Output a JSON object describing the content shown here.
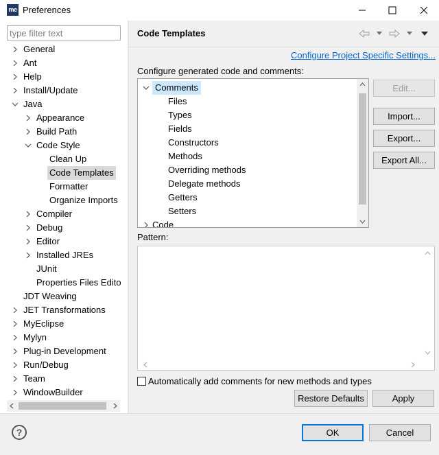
{
  "window": {
    "title": "Preferences",
    "app_icon_text": "me"
  },
  "left": {
    "filter_placeholder": "type filter text",
    "tree": [
      {
        "label": "General",
        "level": 0,
        "arrow": "right"
      },
      {
        "label": "Ant",
        "level": 0,
        "arrow": "right"
      },
      {
        "label": "Help",
        "level": 0,
        "arrow": "right"
      },
      {
        "label": "Install/Update",
        "level": 0,
        "arrow": "right"
      },
      {
        "label": "Java",
        "level": 0,
        "arrow": "down"
      },
      {
        "label": "Appearance",
        "level": 1,
        "arrow": "right"
      },
      {
        "label": "Build Path",
        "level": 1,
        "arrow": "right"
      },
      {
        "label": "Code Style",
        "level": 1,
        "arrow": "down"
      },
      {
        "label": "Clean Up",
        "level": 2,
        "arrow": "none"
      },
      {
        "label": "Code Templates",
        "level": 2,
        "arrow": "none",
        "selected": true
      },
      {
        "label": "Formatter",
        "level": 2,
        "arrow": "none"
      },
      {
        "label": "Organize Imports",
        "level": 2,
        "arrow": "none"
      },
      {
        "label": "Compiler",
        "level": 1,
        "arrow": "right"
      },
      {
        "label": "Debug",
        "level": 1,
        "arrow": "right"
      },
      {
        "label": "Editor",
        "level": 1,
        "arrow": "right"
      },
      {
        "label": "Installed JREs",
        "level": 1,
        "arrow": "right"
      },
      {
        "label": "JUnit",
        "level": 1,
        "arrow": "none"
      },
      {
        "label": "Properties Files Edito",
        "level": 1,
        "arrow": "none"
      },
      {
        "label": "JDT Weaving",
        "level": 0,
        "arrow": "none"
      },
      {
        "label": "JET Transformations",
        "level": 0,
        "arrow": "right"
      },
      {
        "label": "MyEclipse",
        "level": 0,
        "arrow": "right"
      },
      {
        "label": "Mylyn",
        "level": 0,
        "arrow": "right"
      },
      {
        "label": "Plug-in Development",
        "level": 0,
        "arrow": "right"
      },
      {
        "label": "Run/Debug",
        "level": 0,
        "arrow": "right"
      },
      {
        "label": "Team",
        "level": 0,
        "arrow": "right"
      },
      {
        "label": "WindowBuilder",
        "level": 0,
        "arrow": "right"
      }
    ]
  },
  "right": {
    "title": "Code Templates",
    "project_link": "Configure Project Specific Settings...",
    "config_label": "Configure generated code and comments:",
    "templates": [
      {
        "label": "Comments",
        "level": 0,
        "arrow": "down",
        "selected": true
      },
      {
        "label": "Files",
        "level": 1
      },
      {
        "label": "Types",
        "level": 1
      },
      {
        "label": "Fields",
        "level": 1
      },
      {
        "label": "Constructors",
        "level": 1
      },
      {
        "label": "Methods",
        "level": 1
      },
      {
        "label": "Overriding methods",
        "level": 1
      },
      {
        "label": "Delegate methods",
        "level": 1
      },
      {
        "label": "Getters",
        "level": 1
      },
      {
        "label": "Setters",
        "level": 1
      },
      {
        "label": "Code",
        "level": 0,
        "arrow": "right"
      }
    ],
    "buttons": {
      "edit": "Edit...",
      "import": "Import...",
      "export": "Export...",
      "export_all": "Export All..."
    },
    "pattern_label": "Pattern:",
    "checkbox_label": "Automatically add comments for new methods and types",
    "restore_defaults": "Restore Defaults",
    "apply": "Apply"
  },
  "bottom": {
    "help_glyph": "?",
    "ok": "OK",
    "cancel": "Cancel"
  }
}
